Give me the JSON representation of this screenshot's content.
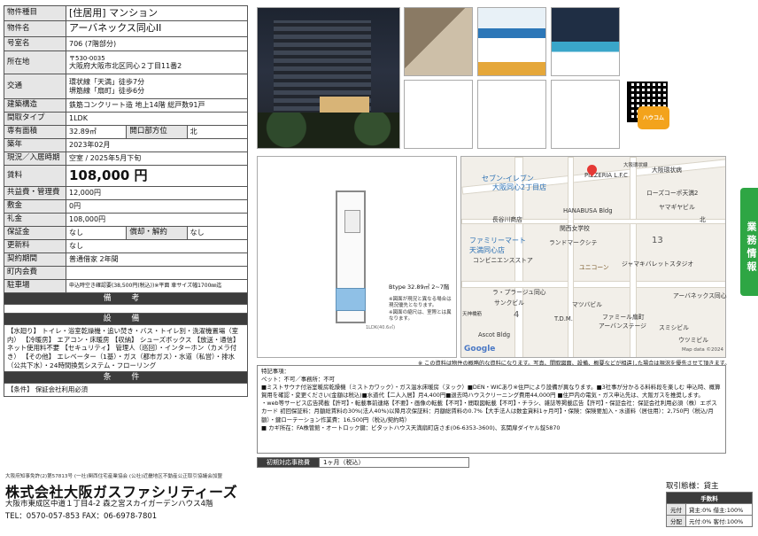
{
  "spec": {
    "type_label": "物件種目",
    "type_value": "[住居用] マンション",
    "name_label": "物件名",
    "name_value": "アーバネックス同心II",
    "room_label": "号室名",
    "room_value": "706 (7階部分)",
    "address_label": "所在地",
    "postal": "〒530-0035",
    "address": "大阪府大阪市北区同心２丁目11番2",
    "transport_label": "交通",
    "transport_1": "環状線「天満」徒歩7分",
    "transport_2": "堺筋線「扇町」徒歩6分",
    "structure_label": "建築構造",
    "structure_value": "鉄筋コンクリート造 地上14階 総戸数91戸",
    "layout_label": "間取タイプ",
    "layout_value": "1LDK",
    "area_label": "専有面積",
    "area_value": "32.89㎡",
    "direction_label": "開口部方位",
    "direction_value": "北",
    "built_label": "築年",
    "built_value": "2023年02月",
    "status_label": "現況／入居時期",
    "status_value": "空室 / 2025年5月下旬",
    "rent_label": "賃料",
    "rent_value": "108,000 円",
    "mgmt_label": "共益費・管理費",
    "mgmt_value": "12,000円",
    "deposit_label": "敷金",
    "deposit_value": "0円",
    "keymoney_label": "礼金",
    "keymoney_value": "108,000円",
    "guarantee_label": "保証金",
    "guarantee_value": "なし",
    "amort_label": "償却・解約",
    "amort_value": "なし",
    "renew_label": "更新料",
    "renew_value": "なし",
    "contract_label": "契約期間",
    "contract_value": "普通借家 2年間",
    "town_label": "町内会費",
    "town_value": "",
    "parking_label": "駐車場",
    "parking_value": "申込時空き確認要(38,500円(税込))※平面 車サイズ幅1700㎜迄",
    "remarks_header": "備 考",
    "equip_header": "設 備",
    "equipment": "【水廻り】 トイレ・浴室乾燥機・追い焚き・バス・トイレ別・洗濯機置場（室内） 【冷暖房】 エアコン・床暖房 【収納】 シューズボックス 【放送・通信】 ネット使用料不要 【セキュリティ】 管理人（巡回）・インターホン（カメラ付き） 【その他】 エレベーター（1基）・ガス（都市ガス）・水道（私営）・排水（公共下水）・24時間換気システム・フローリング",
    "terms_header": "条 件",
    "terms": "【条件】 保証会社利用必須"
  },
  "plan": {
    "spec_text": "Btype 32.89㎡ 2~7階",
    "note_1": "※図面が現況と異なる場合は",
    "note_2": "現況優先となります。",
    "note_3": "※図面の縮尺は、室際とは異",
    "note_4": "なります。",
    "dim": "1LDK(40.6㎡)"
  },
  "map": {
    "labels": {
      "seven": "セブン-イレブン",
      "seven2": "大阪同心2丁目店",
      "pizzeria": "PIZZERIA L.F.C",
      "osaka_hospital": "大阪環状病",
      "lawson": "ローズコーポ天満2",
      "ideya": "長谷川商店",
      "hanabusa": "HANABUSA Bldg",
      "yamasaki": "ヤマギヤビル",
      "kitamura": "北",
      "school": "関西女学校",
      "famima": "ファミリーマート",
      "famima2": "天満同心店",
      "famima3": "コンビニエンスストア",
      "landmark": "ランドマークシテ",
      "unicorn": "ユニコーン",
      "jyama": "ジャマキバレットスタジオ",
      "labra": "ラ・プラージュ同心",
      "sunnbiru": "サンクビル",
      "mitsubi": "マツバビル",
      "tdm": "T.D.M.",
      "famille": "ファミール扇町",
      "famille2": "アーバンステージ",
      "urbanex": "アーバネックス同心",
      "ascot": "Ascot Bldg",
      "sumishi": "スミシビル",
      "utsumi": "ウツミビル",
      "num13": "13",
      "num4": "4",
      "road": "天神橋筋",
      "street": "大阪環状線"
    },
    "google": "Google",
    "mapdata": "Map data ©2024"
  },
  "side_tab": "業務情報",
  "caveat": "※ この資料は物件の概略的な資料になります。写真、間取図面、設備、概要などが相違した場合は現況を優先させて頂きます。",
  "remarks": {
    "line_1": "特記事項：",
    "line_2": "ペット：不可／事務所：不可",
    "line_3": "■ミストサウナ付浴室暖房乾燥機（ミストカワック）・ガス温水床暖房（ヌック）■DEN・WICあり※住戸により設備が異なります。■3社事が分かるる料料段を楽しむ 申込時、概算賀用を確認・変更ください(金額は税込)■水道代【二人入居】月4,400円■退去時ハウスクリーニング費用44,000円 ■住戸内の電気・ガス申込先は、大阪ガスを推奨します。",
    "line_4": "・web等サービス広告掲載【許可】・転載事前連絡【不要】・画像の転載【不可】・間取図転載【不可】・チラシ、雑誌等掲載広告【許可】・保証会社：保証会社利用必須（株）エポスカード 初回保証料：月額総賃料の30%(法人40%)以降月次保証料：月額総賃料の0.7%【大手法人は数金貨料1ヶ月可】・保険：保険要加入・水道料（居住用）：2,750円（税込/月額）・鍵ローテーション作業費：16,500円（税込/契約時）",
    "line_5": "■ カギ所在：FA株管館・オートロック鍵：ビタットハウス天満扇町店さま(06-6353-3600)、玄関扉ダイヤル錠5870"
  },
  "initial": {
    "label": "初期対応事務費",
    "value": "1ヶ月（税込）"
  },
  "footer": {
    "license": "大阪府知事免許(2)第57813号 (一社)関西住宅産業協会 (公社)近畿地区不動産公正取引協議会加盟",
    "company": "株式会社大阪ガスファシリティーズ",
    "address": "大阪市東成区中道１丁目4-2 森之宮スカイガーデンハウス4階",
    "tel": "TEL：0570-057-853 FAX：06-6978-7801",
    "trade": "取引態様：貸主",
    "fee_title": "手数料",
    "fee_rows": [
      {
        "h": "元付",
        "v": "貸主:0% 借主:100%"
      },
      {
        "h": "分配",
        "v": "元付:0% 客付:100%"
      }
    ]
  },
  "thumbs": [
    "lobby-photo",
    "flyer-blue",
    "flyer-dark"
  ],
  "qr_badge": "ハウコム"
}
